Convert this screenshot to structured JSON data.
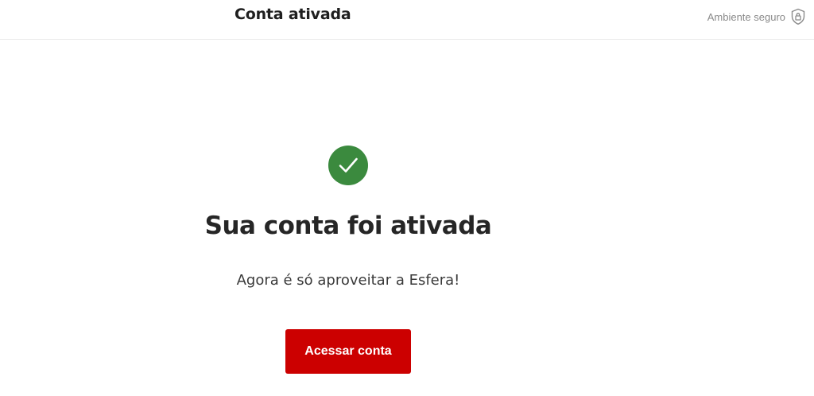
{
  "header": {
    "title": "Conta ativada",
    "secure_label": "Ambiente seguro",
    "secure_icon": "shield-lock-icon"
  },
  "main": {
    "status_icon": "check-icon",
    "heading": "Sua conta foi ativada",
    "subtext": "Agora é só aproveitar a Esfera!",
    "cta_label": "Acessar conta"
  },
  "colors": {
    "success": "#3b8a3e",
    "primary": "#cc0000",
    "text": "#262626",
    "muted": "#8a8a8a"
  }
}
